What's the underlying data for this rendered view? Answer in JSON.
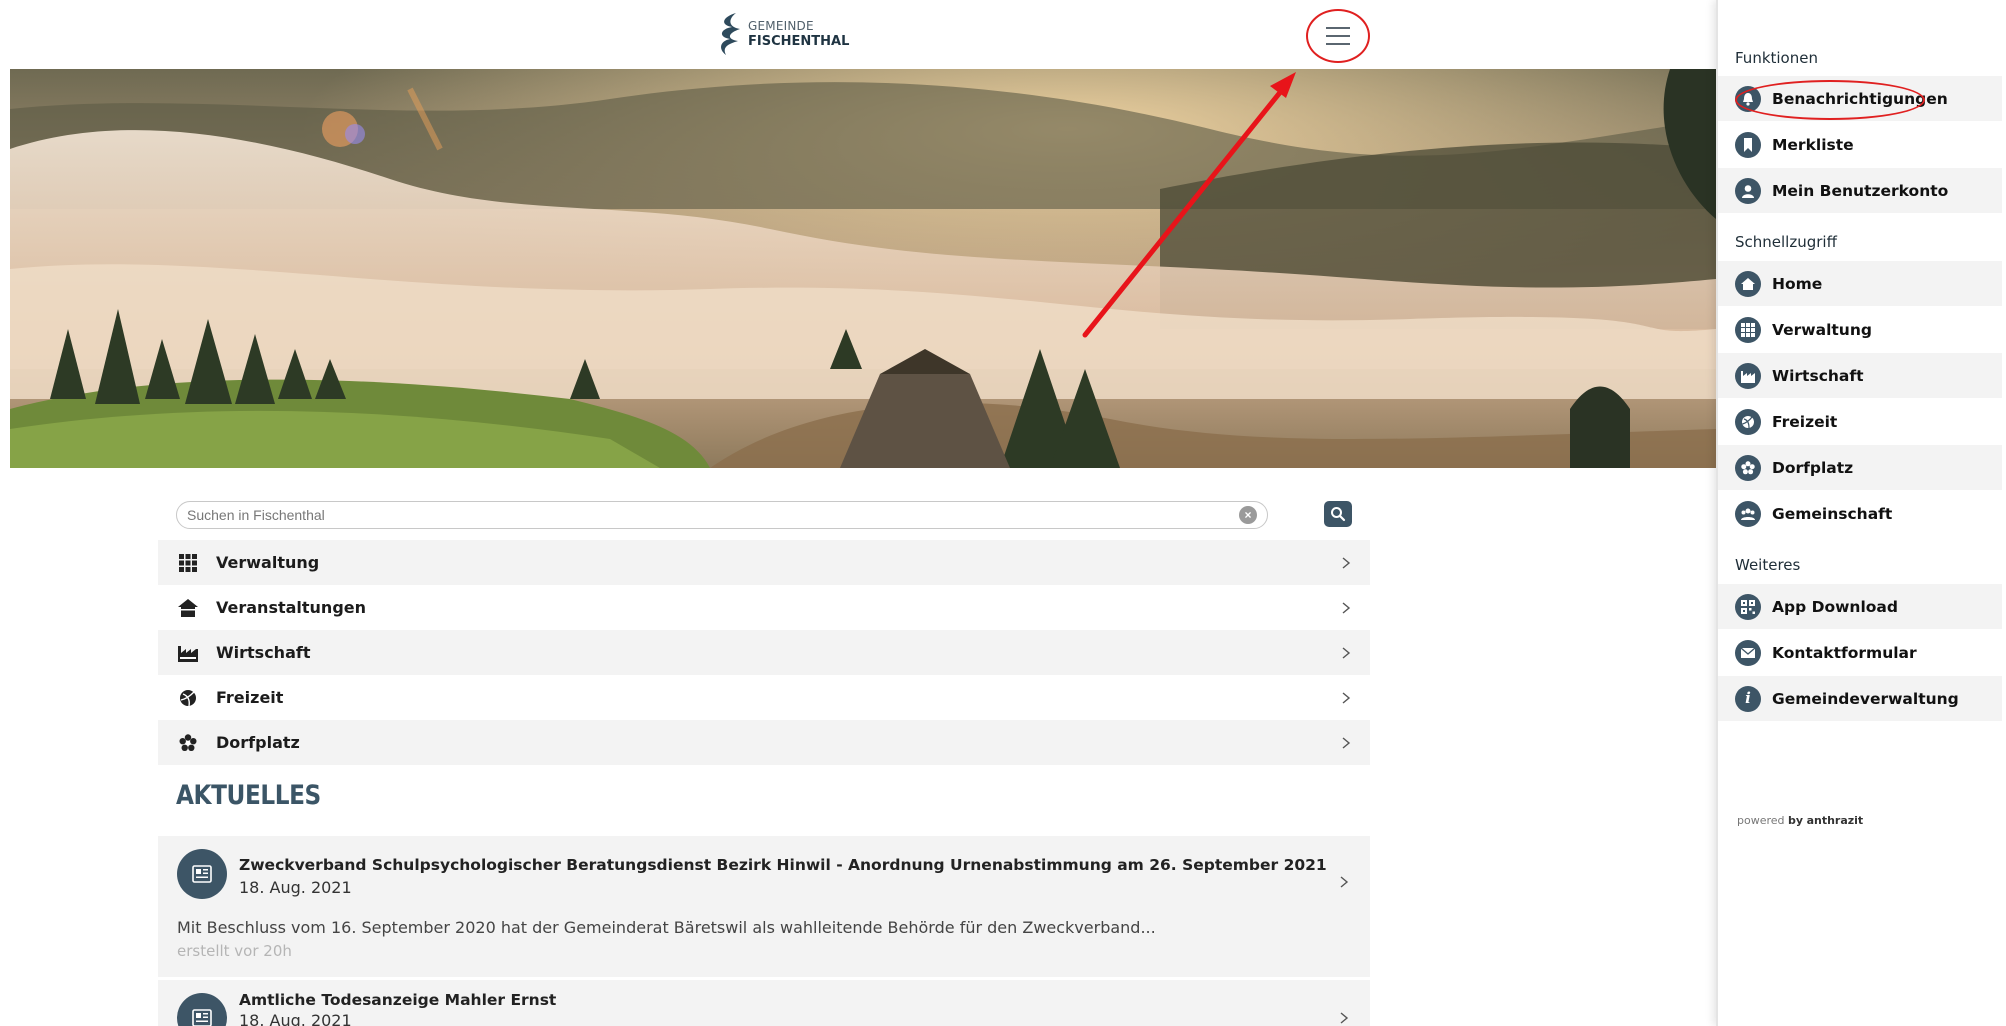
{
  "header": {
    "logo_line1": "GEMEINDE",
    "logo_line2": "FISCHENTHAL",
    "menu_icon": "hamburger-icon"
  },
  "search": {
    "placeholder": "Suchen in Fischenthal",
    "clear_icon": "clear-icon",
    "button_icon": "search-icon"
  },
  "nav": {
    "items": [
      {
        "label": "Verwaltung",
        "icon": "grid-icon"
      },
      {
        "label": "Veranstaltungen",
        "icon": "house-icon"
      },
      {
        "label": "Wirtschaft",
        "icon": "factory-icon"
      },
      {
        "label": "Freizeit",
        "icon": "ball-icon"
      },
      {
        "label": "Dorfplatz",
        "icon": "flower-icon"
      }
    ]
  },
  "news": {
    "section_title": "AKTUELLES",
    "items": [
      {
        "title": "Zweckverband Schulpsychologischer Beratungsdienst Bezirk Hinwil - Anordnung Urnenabstimmung am 26. September 2021",
        "date": "18. Aug. 2021",
        "text": "Mit Beschluss vom 16. September 2020 hat der Gemeinderat Bäretswil als wahlleitende Behörde für den Zweckverband...",
        "meta": "erstellt vor 20h"
      },
      {
        "title": "Amtliche Todesanzeige Mahler Ernst",
        "date": "18. Aug. 2021"
      }
    ]
  },
  "sidepanel": {
    "section_functions": "Funktionen",
    "functions": [
      {
        "label": "Benachrichtigungen",
        "icon": "bell-icon"
      },
      {
        "label": "Merkliste",
        "icon": "bookmark-icon"
      },
      {
        "label": "Mein Benutzerkonto",
        "icon": "user-icon"
      }
    ],
    "section_quick": "Schnellzugriff",
    "quick": [
      {
        "label": "Home",
        "icon": "home-icon"
      },
      {
        "label": "Verwaltung",
        "icon": "grid-icon"
      },
      {
        "label": "Wirtschaft",
        "icon": "factory-icon"
      },
      {
        "label": "Freizeit",
        "icon": "ball-icon"
      },
      {
        "label": "Dorfplatz",
        "icon": "flower-icon"
      },
      {
        "label": "Gemeinschaft",
        "icon": "group-icon"
      }
    ],
    "section_more": "Weiteres",
    "more": [
      {
        "label": "App Download",
        "icon": "qr-icon"
      },
      {
        "label": "Kontaktformular",
        "icon": "mail-icon"
      },
      {
        "label": "Gemeindeverwaltung",
        "icon": "info-icon"
      }
    ],
    "powered_prefix": "powered",
    "powered_by": "by",
    "powered_brand": "anthrazit"
  },
  "colors": {
    "brand": "#3d5566",
    "annotation": "#e02020",
    "row_shade": "#f3f3f3"
  }
}
